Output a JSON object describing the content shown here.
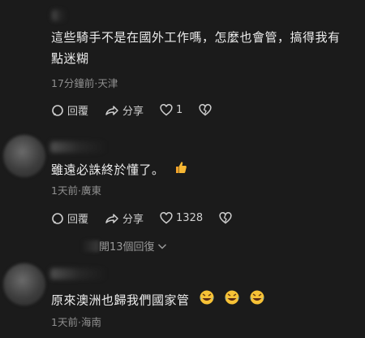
{
  "comments": [
    {
      "text": "這些騎手不是在國外工作嗎，怎麼也會管，搞得我有點迷糊",
      "time": "17分鐘前",
      "location": "天津",
      "reply_label": "回覆",
      "share_label": "分享",
      "like_count": "1"
    },
    {
      "text": "雖遠必誅終於懂了。",
      "emoji": "thumbs-up",
      "time": "1天前",
      "location": "廣東",
      "reply_label": "回覆",
      "share_label": "分享",
      "like_count": "1328"
    },
    {
      "text": "原來澳洲也歸我們國家管",
      "emoji": [
        "laughing-crying",
        "laughing-crying",
        "laughing-crying"
      ],
      "time": "1天前",
      "location": "海南"
    }
  ],
  "replies_toggle": "開13個回復"
}
